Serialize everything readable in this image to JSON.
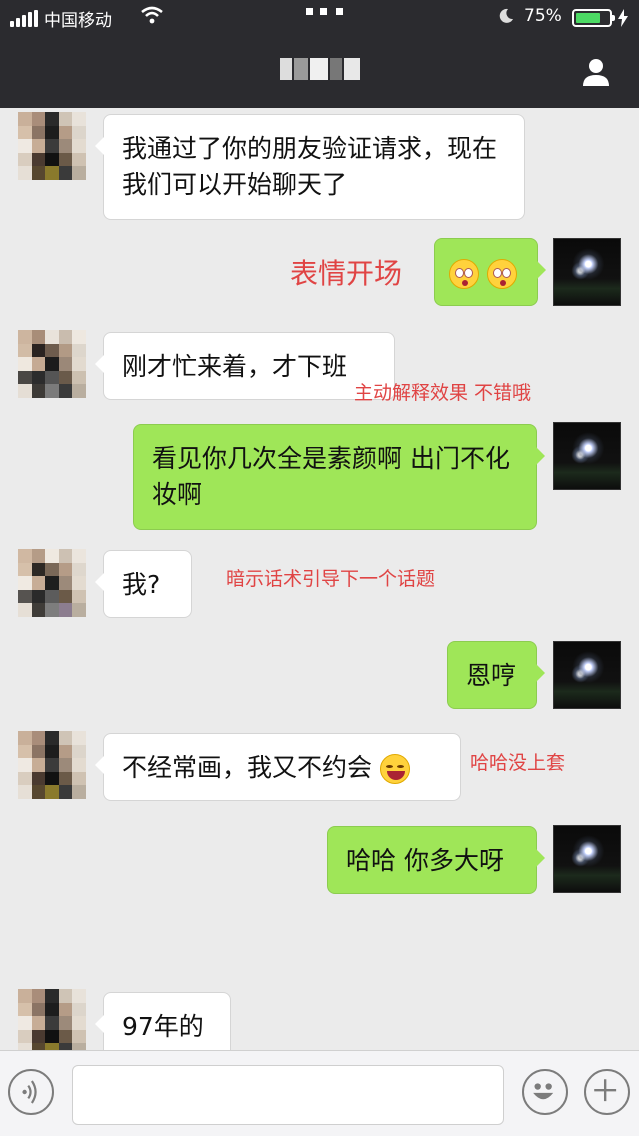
{
  "status_bar": {
    "carrier": "中国移动",
    "battery_percent": "75%",
    "battery_level": 0.75
  },
  "header": {
    "profile_icon": "person-icon"
  },
  "messages": [
    {
      "side": "left",
      "text": "我通过了你的朋友验证请求，现在我们可以开始聊天了"
    },
    {
      "side": "right",
      "text": "",
      "emoji": [
        "flushed-face",
        "flushed-face"
      ]
    },
    {
      "side": "left",
      "text": "刚才忙来着，才下班"
    },
    {
      "side": "right",
      "text": "看见你几次全是素颜啊 出门不化妆啊"
    },
    {
      "side": "left",
      "text": "我?"
    },
    {
      "side": "right",
      "text": "恩哼"
    },
    {
      "side": "left",
      "text": "不经常画，我又不约会",
      "emoji": [
        "tears-of-joy"
      ]
    },
    {
      "side": "right",
      "text": "哈哈 你多大呀"
    },
    {
      "side": "left",
      "text": "97年的"
    }
  ],
  "annotations": {
    "a1": "表情开场",
    "a2": "主动解释效果 不错哦",
    "a3": "暗示话术引导下一个话题",
    "a4": "哈哈没上套"
  },
  "input_bar": {
    "voice_icon": "voice-icon",
    "emoji_icon": "smiley-icon",
    "plus_icon": "plus-icon",
    "input_value": ""
  },
  "colors": {
    "nav_bg": "#2b2b2f",
    "chat_bg": "#ebebeb",
    "sent_bubble": "#9fe658",
    "received_bubble": "#ffffff",
    "annotation": "#e04444",
    "battery": "#4cd964"
  }
}
